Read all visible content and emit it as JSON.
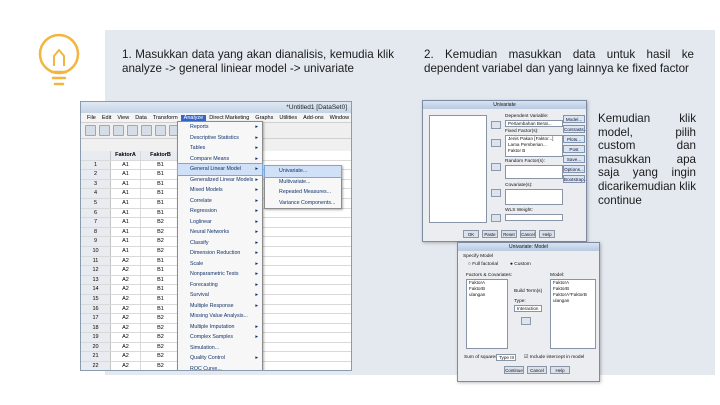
{
  "captions": {
    "step1": "1. Masukkan data yang akan dianalisis, kemudia klik analyze -> general liniear model -> univariate",
    "step2": "2. Kemudian masukkan data untuk hasil ke dependent variabel dan yang lainnya ke fixed factor",
    "step3": "Kemudian klik model, pilih custom dan masukkan apa saja yang ingin dicarikemudian klik continue"
  },
  "spss": {
    "title": "*Untitled1 [DataSet0]",
    "menu": [
      "File",
      "Edit",
      "View",
      "Data",
      "Transform",
      "Analyze",
      "Direct Marketing",
      "Graphs",
      "Utilities",
      "Add-ons",
      "Window",
      "Help"
    ],
    "active_menu": "Analyze",
    "columns": [
      "",
      "FaktorA",
      "FaktorB"
    ],
    "rows": [
      [
        "1",
        "A1",
        "B1"
      ],
      [
        "2",
        "A1",
        "B1"
      ],
      [
        "3",
        "A1",
        "B1"
      ],
      [
        "4",
        "A1",
        "B1"
      ],
      [
        "5",
        "A1",
        "B1"
      ],
      [
        "6",
        "A1",
        "B1"
      ],
      [
        "7",
        "A1",
        "B2"
      ],
      [
        "8",
        "A1",
        "B2"
      ],
      [
        "9",
        "A1",
        "B2"
      ],
      [
        "10",
        "A1",
        "B2"
      ],
      [
        "11",
        "A2",
        "B1"
      ],
      [
        "12",
        "A2",
        "B1"
      ],
      [
        "13",
        "A2",
        "B1"
      ],
      [
        "14",
        "A2",
        "B1"
      ],
      [
        "15",
        "A2",
        "B1"
      ],
      [
        "16",
        "A2",
        "B1"
      ],
      [
        "17",
        "A2",
        "B2"
      ],
      [
        "18",
        "A2",
        "B2"
      ],
      [
        "19",
        "A2",
        "B2"
      ],
      [
        "20",
        "A2",
        "B2"
      ],
      [
        "21",
        "A2",
        "B2"
      ],
      [
        "22",
        "A2",
        "B2"
      ]
    ],
    "analyze_menu": [
      "Reports",
      "Descriptive Statistics",
      "Tables",
      "Compare Means",
      "General Linear Model",
      "Generalized Linear Models",
      "Mixed Models",
      "Correlate",
      "Regression",
      "Loglinear",
      "Neural Networks",
      "Classify",
      "Dimension Reduction",
      "Scale",
      "Nonparametric Tests",
      "Forecasting",
      "Survival",
      "Multiple Response",
      "Missing Value Analysis...",
      "Multiple Imputation",
      "Complex Samples",
      "Simulation...",
      "Quality Control",
      "ROC Curve..."
    ],
    "highlighted_menu": "General Linear Model",
    "glm_submenu": [
      "Univariate...",
      "Multivariate...",
      "Repeated Measures...",
      "Variance Components..."
    ],
    "highlighted_submenu": "Univariate..."
  },
  "univariate": {
    "title": "Univariate",
    "dependent_label": "Dependent Variable:",
    "dependent_value": "Pertambahan Berat...",
    "fixed_label": "Fixed Factor(s):",
    "fixed_values": [
      "Jenis Pakan [Faktor...]",
      "Lama Pemberian...",
      "Faktor B"
    ],
    "random_label": "Random Factor(s):",
    "covariate_label": "Covariate(s):",
    "wls_label": "WLS Weight:",
    "side_buttons": [
      "Model...",
      "Contrasts...",
      "Plots...",
      "Post Hoc...",
      "Save...",
      "Options...",
      "Bootstrap..."
    ],
    "bottom_buttons": [
      "OK",
      "Paste",
      "Reset",
      "Cancel",
      "Help"
    ]
  },
  "model_dialog": {
    "title": "Univariate: Model",
    "specify_label": "Specify Model",
    "opt_full": "Full factorial",
    "opt_custom": "Custom",
    "factors_label": "Factors & Covariates:",
    "factors": [
      "FaktorA",
      "FaktorB",
      "ulangan"
    ],
    "model_label": "Model:",
    "model_terms": [
      "FaktorA",
      "FaktorB",
      "FaktorA*FaktorB",
      "ulangan"
    ],
    "build_label": "Build Term(s)",
    "type_label": "Type:",
    "type_value": "Interaction",
    "ss_label": "Sum of squares:",
    "ss_value": "Type III",
    "include_label": "Include intercept in model",
    "buttons": [
      "Continue",
      "Cancel",
      "Help"
    ]
  }
}
